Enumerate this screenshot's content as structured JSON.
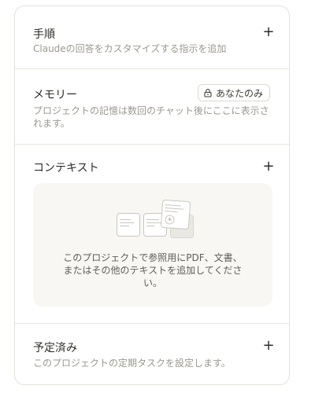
{
  "instructions": {
    "title": "手順",
    "description": "Claudeの回答をカスタマイズする指示を追加",
    "add_label": "+"
  },
  "memory": {
    "title": "メモリー",
    "badge_label": "あなたのみ",
    "description_line1": "プロジェクトの記憶は数回のチャット後にここに表示さ",
    "description_line2": "れます。"
  },
  "context": {
    "title": "コンテキスト",
    "add_label": "+",
    "empty_line1": "このプロジェクトで参照用にPDF、文書、",
    "empty_line2": "またはその他のテキストを追加してくださ",
    "empty_line3": "い。"
  },
  "scheduled": {
    "title": "予定済み",
    "description": "このプロジェクトの定期タスクを設定します。",
    "add_label": "+"
  }
}
